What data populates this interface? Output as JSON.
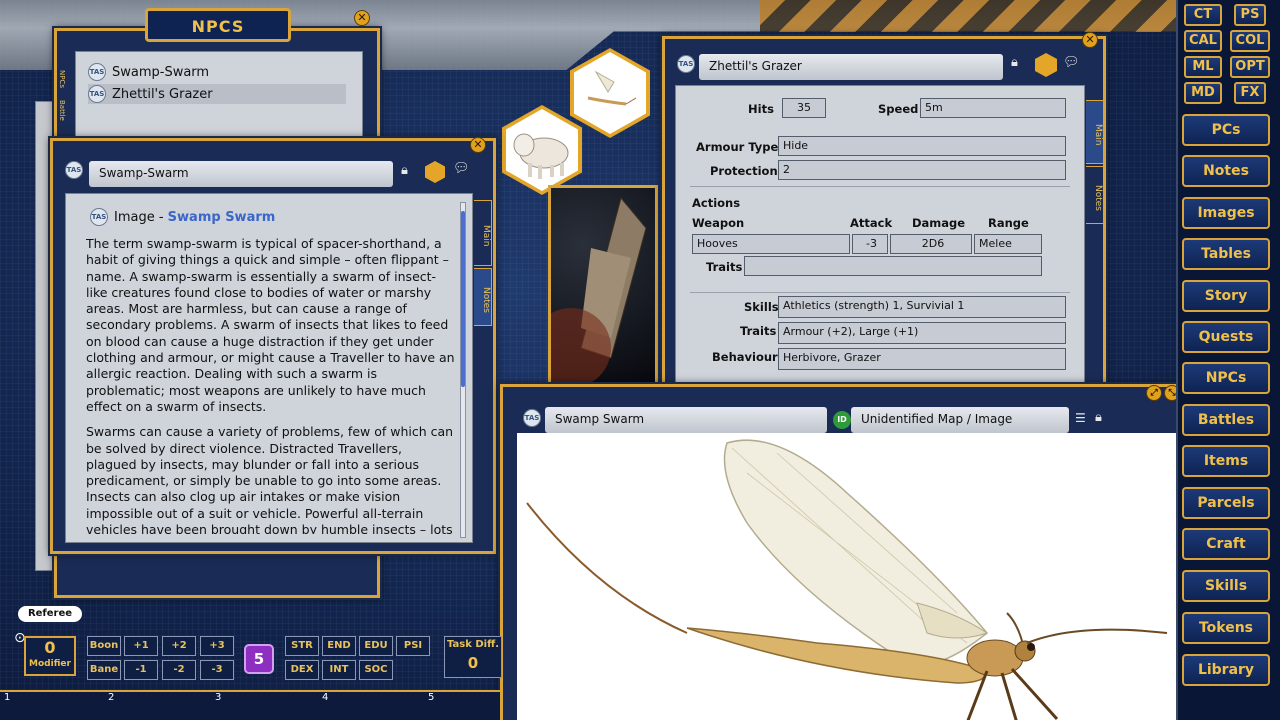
{
  "npcs_window": {
    "title": "NPCS",
    "items": [
      "Swamp-Swarm",
      "Zhettil's Grazer"
    ],
    "side_tabs": [
      "NPCs",
      "Battle"
    ]
  },
  "swarm_sheet": {
    "tas": "TAS",
    "name": "Swamp-Swarm",
    "header_prefix": "Image - ",
    "header_link": "Swamp Swarm",
    "paragraphs": [
      "The term swamp-swarm is typical of spacer-shorthand, a habit of giving things a quick and simple – often flippant – name. A swamp-swarm is essentially a swarm of insect-like creatures found close to bodies of water or marshy areas. Most are harmless, but can cause a range of secondary problems. A swarm of insects that likes to feed on blood can cause a huge distraction if they get under clothing and armour, or might cause a Traveller to have an allergic reaction. Dealing with such a swarm is problematic; most weapons are unlikely to have much effect on a swarm of insects.",
      "Swarms can cause a variety of problems, few of which can be solved by direct violence. Distracted Travellers, plagued by insects, may blunder or fall into a serious predicament, or simply be unable to go into some areas. Insects can also clog up air intakes or make vision impossible out of a suit or vehicle. Powerful all-terrain vehicles have been brought down by humble insects – lots of them – and an"
    ],
    "tabs": [
      "Main",
      "Notes"
    ]
  },
  "grazer_sheet": {
    "name": "Zhettil's Grazer",
    "hits_label": "Hits",
    "hits": "35",
    "speed_label": "Speed",
    "speed": "5m",
    "armour_type_label": "Armour Type",
    "armour_type": "Hide",
    "protection_label": "Protection",
    "protection": "2",
    "actions_label": "Actions",
    "weapon_label": "Weapon",
    "attack_label": "Attack",
    "damage_label": "Damage",
    "range_label": "Range",
    "weapon": "Hooves",
    "attack": "-3",
    "damage": "2D6",
    "range": "Melee",
    "traits_label": "Traits",
    "weapon_traits": "",
    "skills_label": "Skills",
    "skills": "Athletics (strength) 1, Survivial 1",
    "traits": "Armour (+2), Large (+1)",
    "behaviour_label": "Behaviour",
    "behaviour": "Herbivore, Grazer",
    "tabs": [
      "Main",
      "Notes"
    ]
  },
  "image_window": {
    "title": "Swamp Swarm",
    "id_badge": "ID",
    "id_label": "Unidentified Map / Image"
  },
  "sidebar": {
    "small_buttons": [
      "CT",
      "PS",
      "CAL",
      "COL",
      "ML",
      "OPT",
      "MD",
      "FX"
    ],
    "buttons": [
      "PCs",
      "Notes",
      "Images",
      "Tables",
      "Story",
      "Quests",
      "NPCs",
      "Battles",
      "Items",
      "Parcels",
      "Craft",
      "Skills",
      "Tokens",
      "Library"
    ]
  },
  "bottom_bar": {
    "referee": "Referee",
    "modifier_value": "0",
    "modifier_label": "Modifier",
    "boon": "Boon",
    "bane": "Bane",
    "plus": [
      "+1",
      "+2",
      "+3"
    ],
    "minus": [
      "-1",
      "-2",
      "-3"
    ],
    "dice": "5",
    "stats_top": [
      "STR",
      "END",
      "EDU",
      "PSI"
    ],
    "stats_bottom": [
      "DEX",
      "INT",
      "SOC"
    ],
    "task_diff_label": "Task Diff.",
    "task_diff_value": "0",
    "hotkeys": [
      "1",
      "2",
      "3",
      "4",
      "5"
    ]
  },
  "colors": {
    "gold": "#d9a53a",
    "panel": "#cfd3da",
    "link": "#3a66c8"
  }
}
